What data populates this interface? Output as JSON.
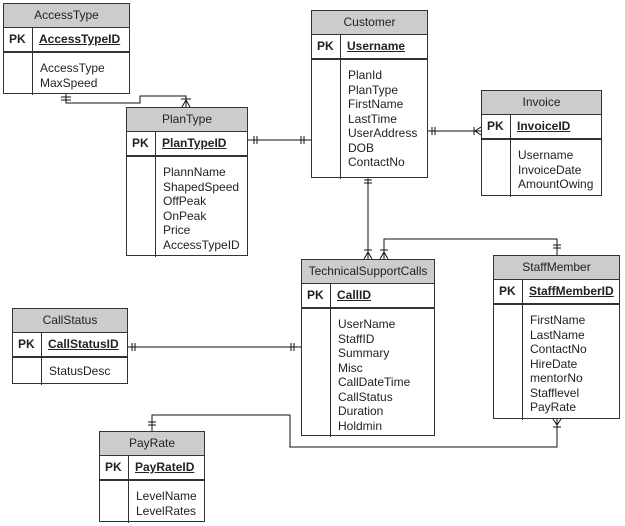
{
  "diagram": {
    "type": "entity-relationship",
    "pk_label": "PK",
    "entities": [
      {
        "id": "accesstype",
        "name": "AccessType",
        "pk": "AccessTypeID",
        "attributes": [
          "AccessType",
          "MaxSpeed"
        ]
      },
      {
        "id": "customer",
        "name": "Customer",
        "pk": "Username",
        "attributes": [
          "PlanId",
          "PlanType",
          "FirstName",
          "LastTime",
          "UserAddress",
          "DOB",
          "ContactNo"
        ]
      },
      {
        "id": "invoice",
        "name": "Invoice",
        "pk": "InvoiceID",
        "attributes": [
          "Username",
          "InvoiceDate",
          "AmountOwing"
        ]
      },
      {
        "id": "plantype",
        "name": "PlanType",
        "pk": "PlanTypeID",
        "attributes": [
          "PlannName",
          "ShapedSpeed",
          "OffPeak",
          "OnPeak",
          "Price",
          "AccessTypeID"
        ]
      },
      {
        "id": "techsupport",
        "name": "TechnicalSupportCalls",
        "pk": "CallID",
        "attributes": [
          "UserName",
          "StaffID",
          "Summary",
          "Misc",
          "CallDateTime",
          "CallStatus",
          "Duration",
          "Holdmin"
        ]
      },
      {
        "id": "staffmember",
        "name": "StaffMember",
        "pk": "StaffMemberID",
        "attributes": [
          "FirstName",
          "LastName",
          "ContactNo",
          "HireDate",
          "mentorNo",
          "Stafflevel",
          "PayRate"
        ]
      },
      {
        "id": "callstatus",
        "name": "CallStatus",
        "pk": "CallStatusID",
        "attributes": [
          "StatusDesc"
        ]
      },
      {
        "id": "payrate",
        "name": "PayRate",
        "pk": "PayRateID",
        "attributes": [
          "LevelName",
          "LevelRates"
        ]
      }
    ],
    "relationships": [
      {
        "from": "AccessType",
        "to": "PlanType",
        "from_card": "one-and-only-one",
        "to_card": "zero-or-many"
      },
      {
        "from": "PlanType",
        "to": "Customer",
        "from_card": "one-and-only-one",
        "to_card": "one-and-only-one"
      },
      {
        "from": "Customer",
        "to": "Invoice",
        "from_card": "one-and-only-one",
        "to_card": "one-or-many"
      },
      {
        "from": "Customer",
        "to": "TechnicalSupportCalls",
        "from_card": "one-and-only-one",
        "to_card": "zero-or-many"
      },
      {
        "from": "StaffMember",
        "to": "TechnicalSupportCalls",
        "from_card": "one-and-only-one",
        "to_card": "zero-or-many"
      },
      {
        "from": "CallStatus",
        "to": "TechnicalSupportCalls",
        "from_card": "one-and-only-one",
        "to_card": "one-and-only-one"
      },
      {
        "from": "PayRate",
        "to": "StaffMember",
        "from_card": "one-and-only-one",
        "to_card": "zero-or-many"
      }
    ]
  }
}
